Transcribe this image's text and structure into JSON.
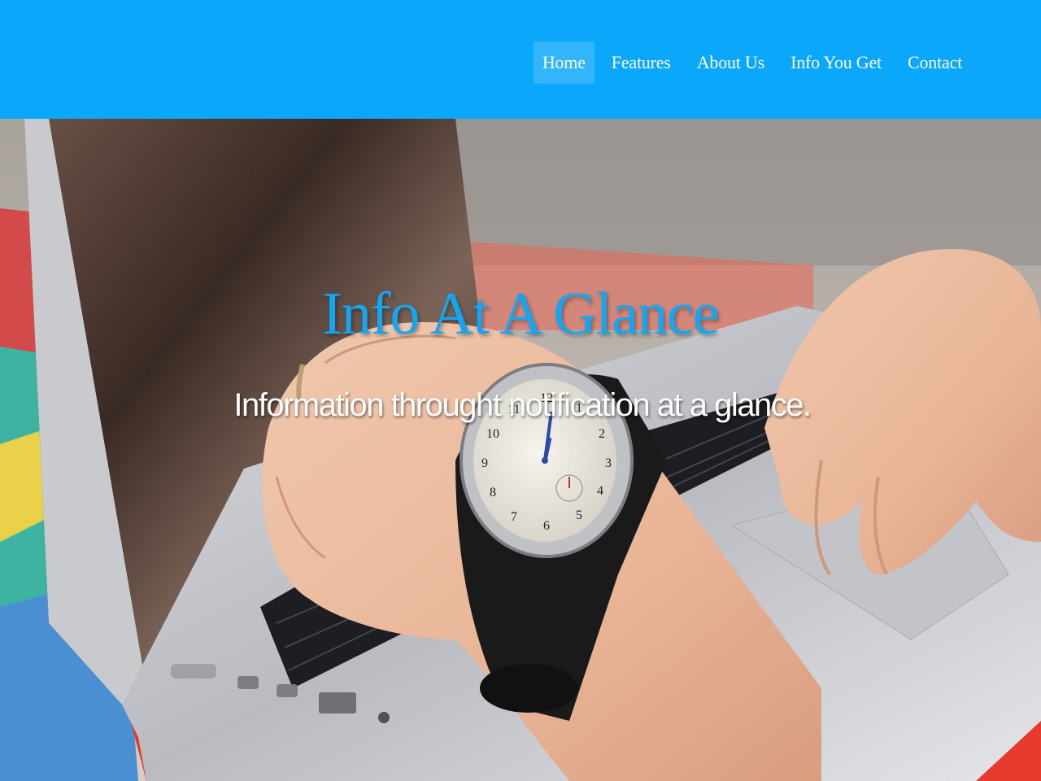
{
  "nav": {
    "items": [
      {
        "label": "Home",
        "active": true
      },
      {
        "label": "Features",
        "active": false
      },
      {
        "label": "About Us",
        "active": false
      },
      {
        "label": "Info You Get",
        "active": false
      },
      {
        "label": "Contact",
        "active": false
      }
    ]
  },
  "hero": {
    "title": "Info At A Glance",
    "subtitle": "Information throught notification at a glance.",
    "image": "laptop-typing-wristwatch-photo"
  },
  "colors": {
    "navbar": "#0ba7fa",
    "title": "#13a6f3",
    "subtitle": "#ffffff"
  }
}
